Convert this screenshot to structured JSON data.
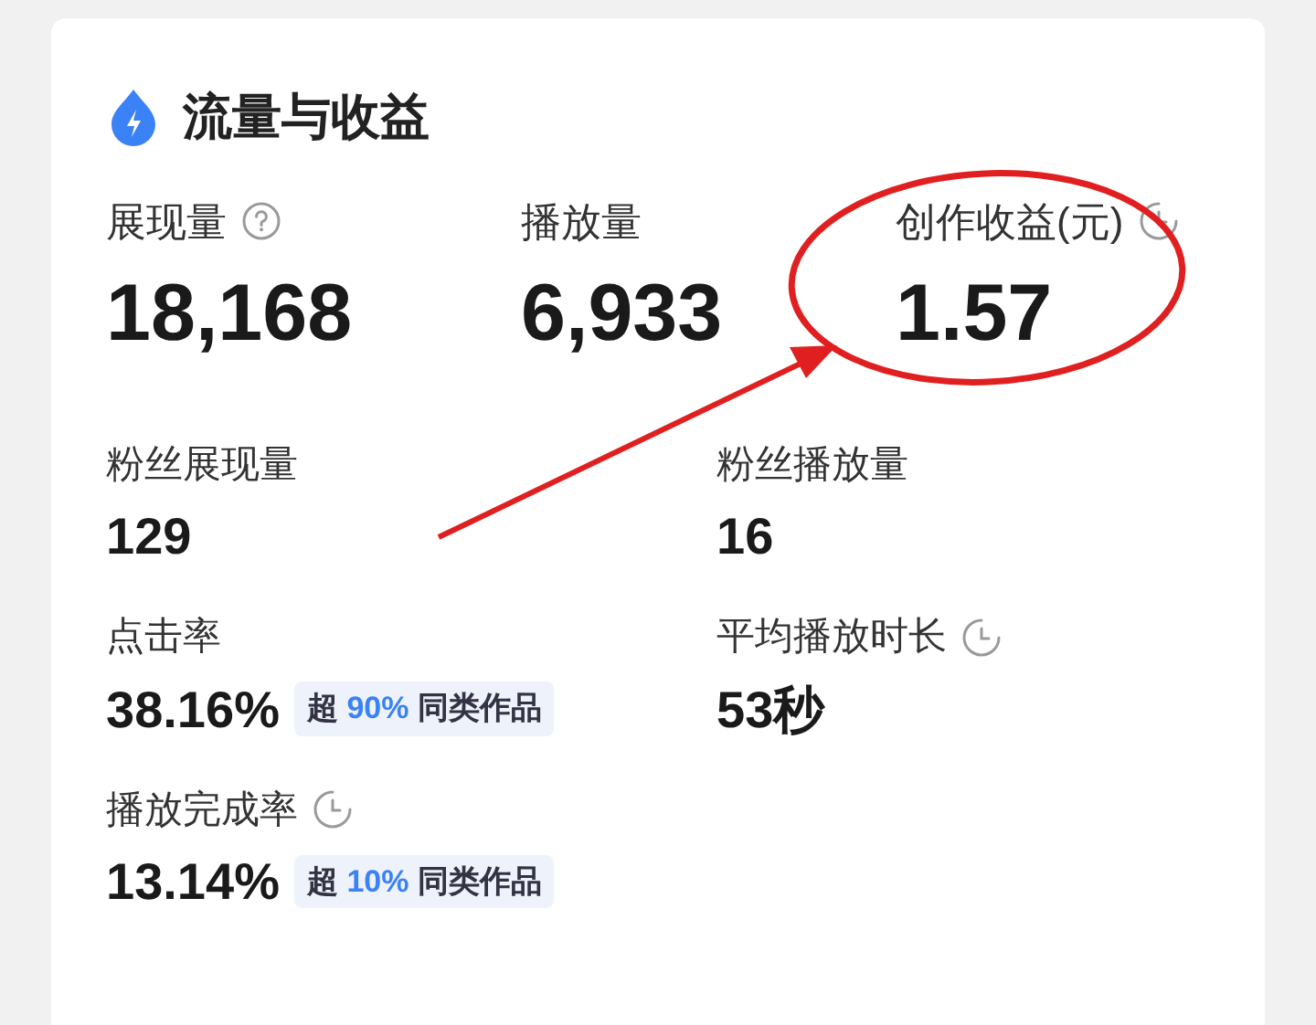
{
  "card": {
    "title": "流量与收益"
  },
  "top_metrics": [
    {
      "kind": "help",
      "label": "展现量",
      "value": "18,168"
    },
    {
      "kind": "plain",
      "label": "播放量",
      "value": "6,933"
    },
    {
      "kind": "timed",
      "label": "创作收益(元)",
      "value": "1.57"
    }
  ],
  "metrics": [
    {
      "kind": "plain",
      "label": "粉丝展现量",
      "value": "129"
    },
    {
      "kind": "plain",
      "label": "粉丝播放量",
      "value": "16"
    },
    {
      "kind": "plain",
      "label": "点击率",
      "value": "38.16%",
      "badge": {
        "prefix": "超",
        "percent": "90%",
        "suffix": "同类作品"
      }
    },
    {
      "kind": "timed",
      "label": "平均播放时长",
      "value": "53秒"
    },
    {
      "kind": "timed",
      "label": "播放完成率",
      "value": "13.14%",
      "badge": {
        "prefix": "超",
        "percent": "10%",
        "suffix": "同类作品"
      }
    }
  ]
}
